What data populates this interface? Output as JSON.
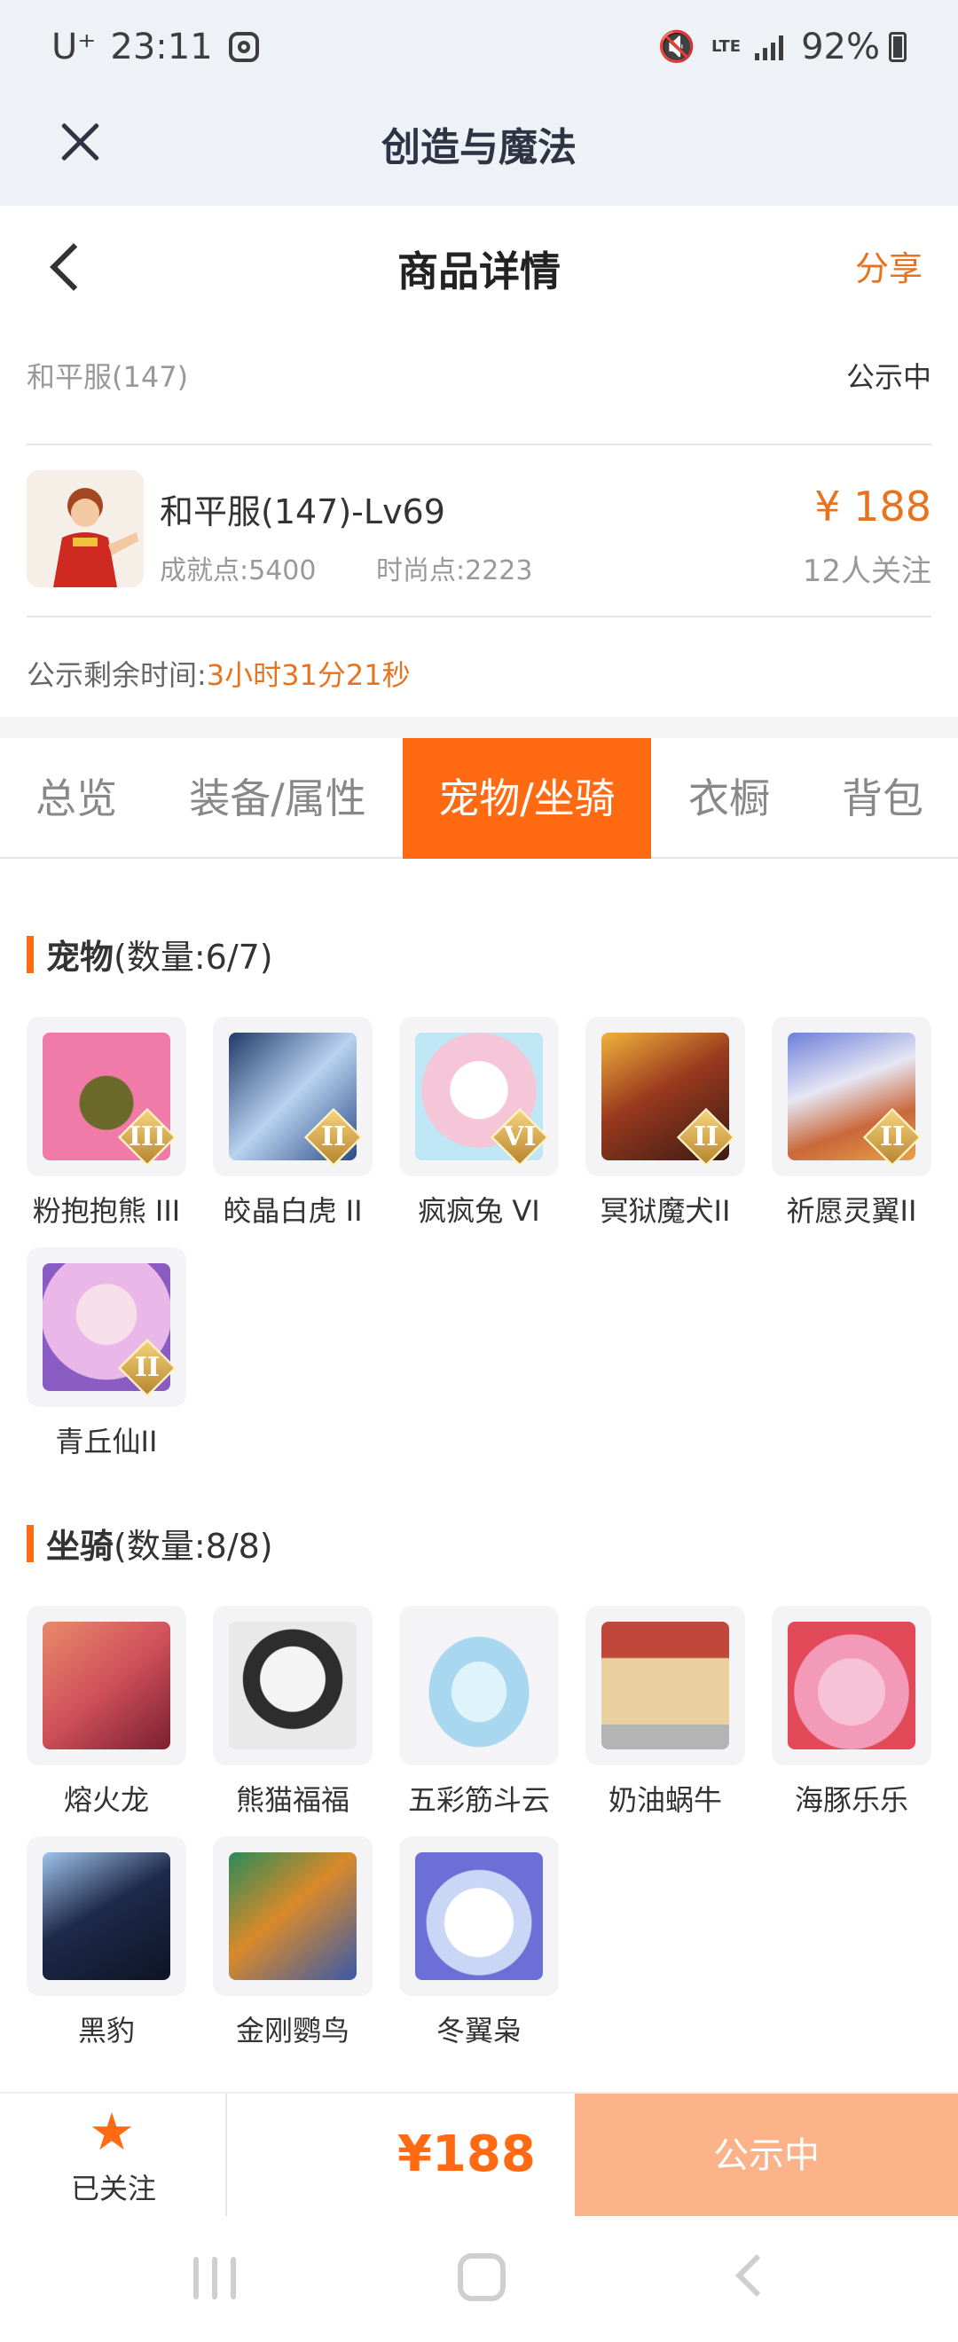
{
  "status_bar": {
    "carrier": "U⁺",
    "time": "23:11",
    "network": "LTE",
    "battery": "92%"
  },
  "app": {
    "title": "创造与魔法"
  },
  "header": {
    "title": "商品详情",
    "share": "分享"
  },
  "listing": {
    "server": "和平服(147)",
    "status": "公示中",
    "name": "和平服(147)-Lv69",
    "achievement": "成就点:5400",
    "fashion": "时尚点:2223",
    "price": "¥ 188",
    "followers": "12人关注",
    "countdown_label": "公示剩余时间:",
    "countdown_value": "3小时31分21秒"
  },
  "tabs": [
    {
      "label": "总览"
    },
    {
      "label": "装备/属性"
    },
    {
      "label": "宠物/坐骑",
      "active": true
    },
    {
      "label": "衣橱"
    },
    {
      "label": "背包"
    }
  ],
  "pets": {
    "title": "宠物",
    "count": "(数量:6/7)",
    "items": [
      {
        "name": "粉抱抱熊 III",
        "rank": "III",
        "color": "#f07aa8"
      },
      {
        "name": "皎晶白虎 II",
        "rank": "II",
        "color": "#4f6fa8"
      },
      {
        "name": "疯疯兔 VI",
        "rank": "VI",
        "color": "#f4c6d8"
      },
      {
        "name": "冥狱魔犬II",
        "rank": "II",
        "color": "#9a3a1e"
      },
      {
        "name": "祈愿灵翼II",
        "rank": "II",
        "color": "#c9683a"
      },
      {
        "name": "青丘仙II",
        "rank": "II",
        "color": "#e9b8e8"
      }
    ]
  },
  "mounts": {
    "title": "坐骑",
    "count": "(数量:8/8)",
    "items": [
      {
        "name": "熔火龙",
        "color": "#d0505a"
      },
      {
        "name": "熊猫福福",
        "color": "#2d2d2d"
      },
      {
        "name": "五彩筋斗云",
        "color": "#a8d8f0"
      },
      {
        "name": "奶油蜗牛",
        "color": "#e9d2a0"
      },
      {
        "name": "海豚乐乐",
        "color": "#f29ab8"
      },
      {
        "name": "黑豹",
        "color": "#1e2a4a"
      },
      {
        "name": "金刚鹦鸟",
        "color": "#d98a2a"
      },
      {
        "name": "冬翼枭",
        "color": "#6c6fd6"
      }
    ]
  },
  "bottom_bar": {
    "follow_label": "已关注",
    "price": "¥188",
    "action": "公示中"
  }
}
